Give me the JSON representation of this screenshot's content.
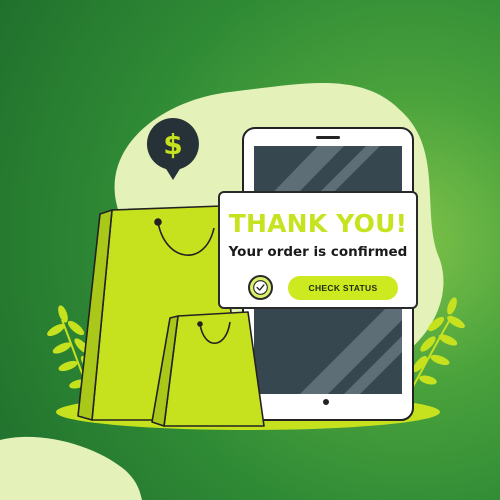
{
  "card": {
    "title": "THANK YOU!",
    "subtitle": "Your order is confirmed",
    "check_status_label": "CHECK STATUS"
  },
  "icons": {
    "currency": "dollar-sign-icon",
    "check": "checkmark-icon"
  },
  "colors": {
    "background_dark": "#1f6f2c",
    "background_light": "#7ec24a",
    "accent_lime": "#c7e31f",
    "blob": "#e3f2b8",
    "phone_screen": "#37474f"
  }
}
